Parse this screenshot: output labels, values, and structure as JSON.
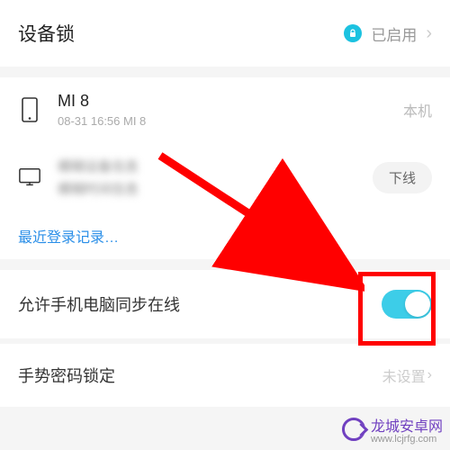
{
  "header": {
    "title": "设备锁",
    "status": "已启用"
  },
  "devices": [
    {
      "name": "MI 8",
      "subtitle": "08-31 16:56 MI 8",
      "badge": "本机",
      "type": "phone"
    },
    {
      "name": "模糊设备信息",
      "subtitle": "模糊时间信息",
      "badge": "下线",
      "type": "desktop"
    }
  ],
  "recentLoginLink": "最近登录记录…",
  "settings": {
    "syncOnline": {
      "label": "允许手机电脑同步在线",
      "on": true
    },
    "gestureLock": {
      "label": "手势密码锁定",
      "value": "未设置"
    }
  },
  "watermark": {
    "text": "龙城安卓网",
    "url": "www.lcjrfg.com"
  }
}
